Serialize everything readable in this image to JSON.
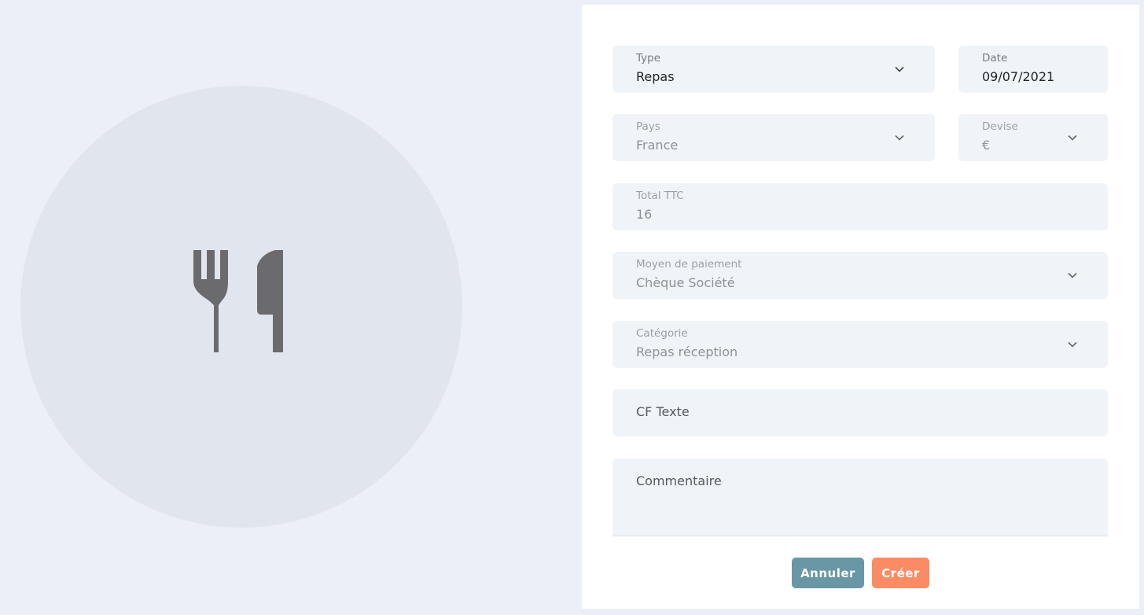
{
  "form": {
    "type": {
      "label": "Type",
      "value": "Repas"
    },
    "date": {
      "label": "Date",
      "value": "09/07/2021"
    },
    "country": {
      "label": "Pays",
      "value": "France"
    },
    "currency": {
      "label": "Devise",
      "value": "€"
    },
    "total": {
      "label": "Total TTC",
      "value": "16"
    },
    "payment": {
      "label": "Moyen de paiement",
      "value": "Chèque Société"
    },
    "category": {
      "label": "Catégorie",
      "value": "Repas réception"
    },
    "cf_text": {
      "placeholder": "CF Texte"
    },
    "comment": {
      "placeholder": "Commentaire"
    }
  },
  "buttons": {
    "cancel": "Annuler",
    "create": "Créer"
  },
  "icons": {
    "illustration": "fork-knife-icon",
    "dropdown": "chevron-down-icon"
  },
  "colors": {
    "cancel_button": "#6a97a5",
    "create_button": "#fb8b65",
    "field_background": "#f0f4f8",
    "illustration_circle": "#e1e5ee",
    "icon": "#6b6b6e"
  }
}
